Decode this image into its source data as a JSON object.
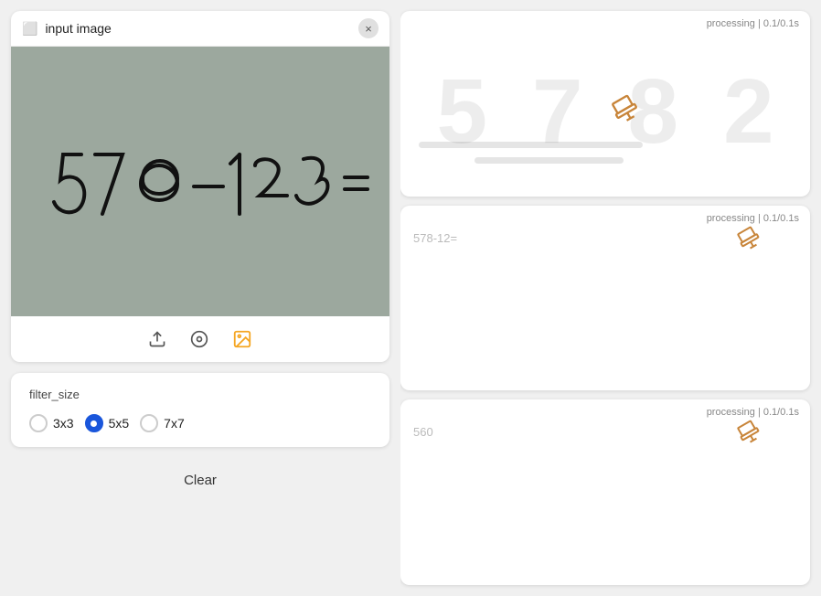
{
  "left": {
    "image_card": {
      "title": "input image",
      "close_label": "×",
      "equation_text": "578 − 123 ="
    },
    "toolbar": {
      "upload_icon": "⬆",
      "camera_icon": "◎",
      "image_icon": "🖼"
    },
    "filter": {
      "label": "filter_size",
      "options": [
        {
          "value": "3x3",
          "label": "3x3",
          "selected": false
        },
        {
          "value": "5x5",
          "label": "5x5",
          "selected": true
        },
        {
          "value": "7x7",
          "label": "7x7",
          "selected": false
        }
      ]
    },
    "clear_button": "Clear"
  },
  "right": {
    "cards": [
      {
        "id": "card1",
        "processing": "processing | 0.1/0.1s",
        "bg_numbers": [
          "5",
          "7",
          "8",
          "2"
        ],
        "size": "large"
      },
      {
        "id": "card2",
        "processing": "processing | 0.1/0.1s",
        "preview_text": "578-12=",
        "size": "small"
      },
      {
        "id": "card3",
        "processing": "processing | 0.1/0.1s",
        "preview_text": "560",
        "size": "small"
      }
    ]
  }
}
